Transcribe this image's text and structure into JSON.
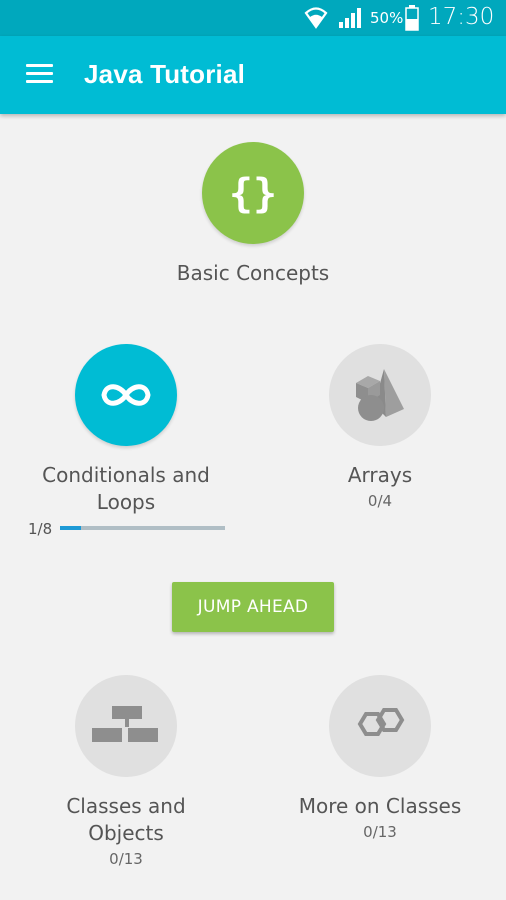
{
  "status_bar": {
    "battery_percent": "50%",
    "time": "17:30",
    "icons": [
      "wifi-icon",
      "signal-icon",
      "battery-icon"
    ]
  },
  "app_bar": {
    "title": "Java Tutorial",
    "menu_icon": "hamburger-menu-icon"
  },
  "lessons": [
    {
      "title": "Basic Concepts",
      "progress": "",
      "state": "completed",
      "icon": "curly-braces-icon"
    },
    {
      "title": "Conditionals and Loops",
      "progress": "",
      "state": "in-progress",
      "icon": "infinity-icon"
    },
    {
      "title": "Arrays",
      "progress": "0/4",
      "state": "locked",
      "icon": "shapes-icon"
    },
    {
      "title": "Classes and Objects",
      "progress": "0/13",
      "state": "locked",
      "icon": "hierarchy-icon"
    },
    {
      "title": "More on Classes",
      "progress": "0/13",
      "state": "locked",
      "icon": "hexagons-icon"
    }
  ],
  "current_progress": {
    "label": "1/8",
    "fraction": 0.125
  },
  "jump_ahead": {
    "label": "JUMP AHEAD"
  },
  "colors": {
    "status_bar": "#00a8bd",
    "app_bar": "#00bcd4",
    "completed": "#8bc34a",
    "in_progress": "#00bcd4",
    "locked": "#e0e0e0",
    "progress_fill": "#1e9ad6",
    "background": "#f2f2f2"
  }
}
